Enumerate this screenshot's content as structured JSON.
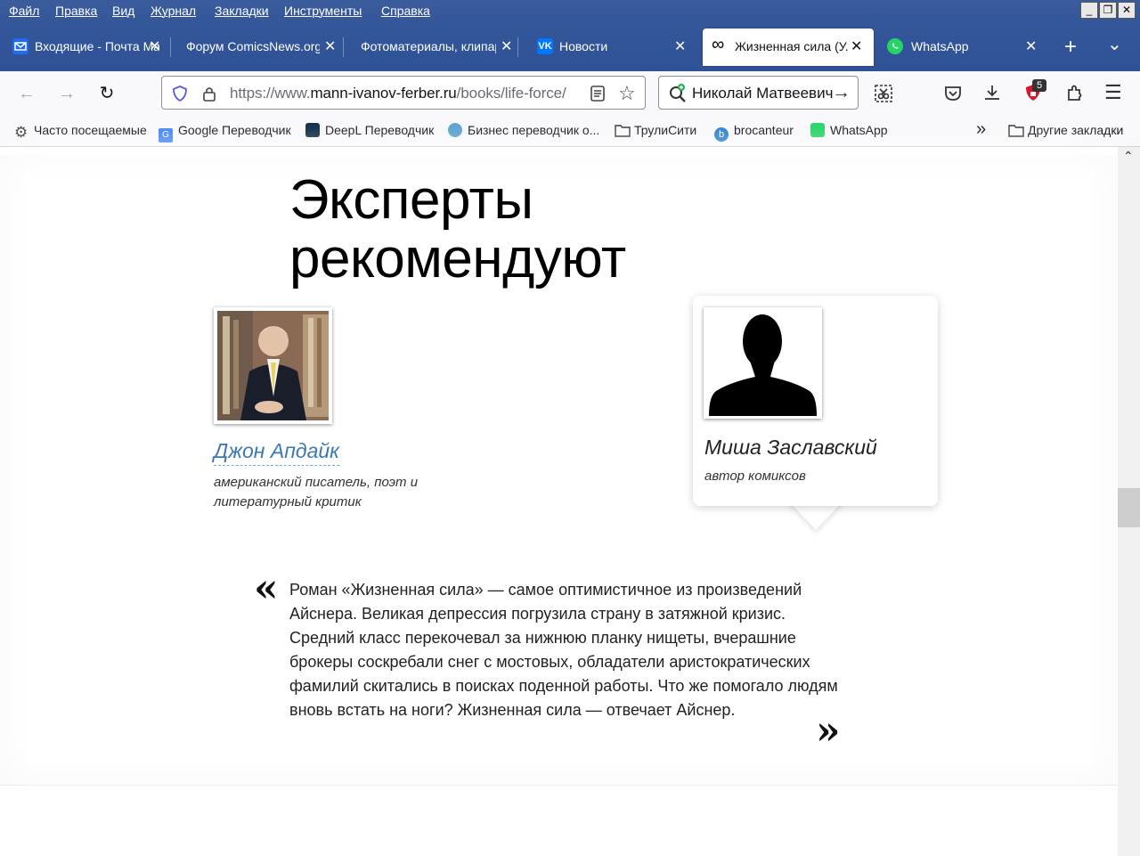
{
  "menu": [
    "Файл",
    "Правка",
    "Вид",
    "Журнал",
    "Закладки",
    "Инструменты",
    "Справка"
  ],
  "window_controls": {
    "minimize": "_",
    "restore": "❐",
    "close": "✕"
  },
  "tabs": [
    {
      "label": "Входящие - Почта Mail.ru",
      "icon": "mail-icon",
      "color": "#005ff9"
    },
    {
      "label": "Форум ComicsNews.org",
      "icon": "forum-icon",
      "color": "#34579a"
    },
    {
      "label": "Фотоматериалы, клипарт",
      "icon": "photo-icon",
      "color": "#34579a"
    },
    {
      "label": "Новости",
      "icon": "vk-icon",
      "color": "#0077ff"
    },
    {
      "label": "Жизненная сила (У. Айснер)",
      "icon": "infinity-icon",
      "color": "#000000"
    },
    {
      "label": "WhatsApp",
      "icon": "whatsapp-icon",
      "color": "#25d366"
    }
  ],
  "new_tab_label": "+",
  "list_tabs_label": "⌄",
  "url": {
    "prefix": "https://www.",
    "domain": "mann-ivanov-ferber.ru",
    "path": "/books/life-force/"
  },
  "extension_label": "Николай Матвеевич",
  "badge_count": "5",
  "bookmarks": [
    {
      "label": "Часто посещаемые",
      "icon": "gear-icon"
    },
    {
      "label": "Google Переводчик",
      "icon": "google-translate-icon"
    },
    {
      "label": "DeepL Переводчик",
      "icon": "deepl-icon"
    },
    {
      "label": "Бизнес переводчик о...",
      "icon": "business-icon"
    },
    {
      "label": "ТрулиСити",
      "icon": "folder-icon"
    },
    {
      "label": "brocanteur",
      "icon": "brocanteur-icon"
    },
    {
      "label": "WhatsApp",
      "icon": "whatsapp-icon"
    }
  ],
  "other_bookmarks": "Другие закладки",
  "overflow": "»",
  "page": {
    "heading_line1": "Эксперты",
    "heading_line2": "рекомендуют",
    "expert1": {
      "name": "Джон Апдайк",
      "desc": "американский писатель, поэт и литературный критик"
    },
    "expert2": {
      "name": "Миша Заславский",
      "desc": "автор комиксов"
    },
    "quote_open": "«",
    "quote_close": "»",
    "quote": "Роман «Жизненная сила» — самое оптимистичное из произведений Айснера. Великая депрессия погрузила страну в затяжной кризис. Средний класс перекочевал за нижнюю планку нищеты, вчерашние брокеры соскребали снег с мостовых, обладатели аристократических фамилий скитались в поисках поденной работы. Что же помогало людям вновь встать на ноги? Жизненная сила — отвечает Айснер."
  },
  "colors": {
    "chrome": "#34579a",
    "link": "#3b78b5"
  }
}
